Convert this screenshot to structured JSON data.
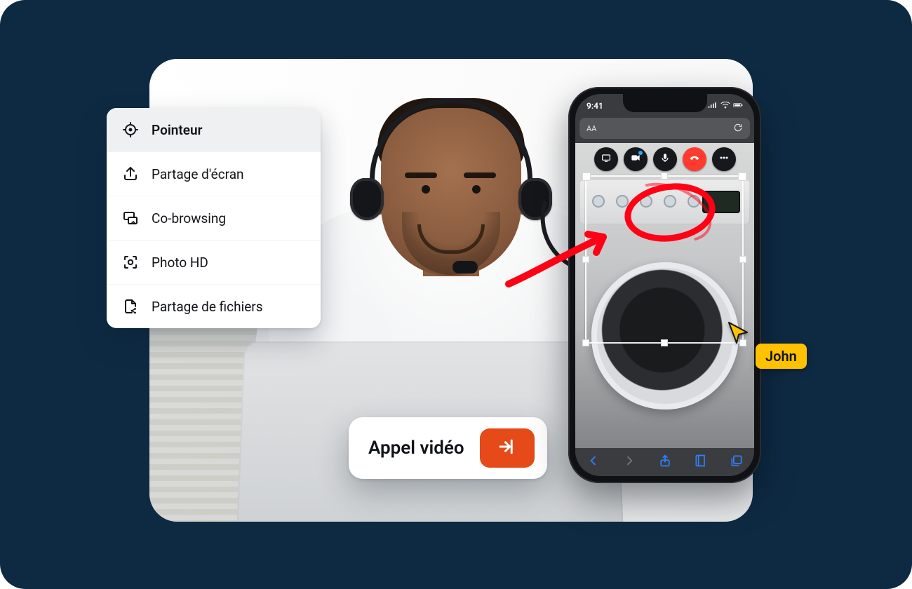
{
  "colors": {
    "background": "#0e2a43",
    "accent": "#e64a19",
    "cursor": "#ffc200",
    "annotation": "#ff0015",
    "safari_tint": "#2f80ff"
  },
  "tools_menu": {
    "items": [
      {
        "icon": "crosshair-icon",
        "label": "Pointeur",
        "selected": true
      },
      {
        "icon": "upload-icon",
        "label": "Partage d'écran",
        "selected": false
      },
      {
        "icon": "cobrowse-icon",
        "label": "Co-browsing",
        "selected": false
      },
      {
        "icon": "camera-focus-icon",
        "label": "Photo HD",
        "selected": false
      },
      {
        "icon": "file-share-icon",
        "label": "Partage de fichiers",
        "selected": false
      }
    ]
  },
  "cta": {
    "label": "Appel vidéo",
    "button_icon": "enter-arrow-icon"
  },
  "phone": {
    "status_time": "9:41",
    "address_bar_left": "AA",
    "address_bar_right_icon": "refresh-icon",
    "call_toolbar": [
      {
        "icon": "screen-icon",
        "style": "dark"
      },
      {
        "icon": "video-icon",
        "style": "dark",
        "indicator": true
      },
      {
        "icon": "microphone-icon",
        "style": "dark"
      },
      {
        "icon": "hangup-icon",
        "style": "red"
      },
      {
        "icon": "more-icon",
        "style": "dark"
      }
    ],
    "safari_bar_icons": [
      "back-icon",
      "forward-icon",
      "share-icon",
      "bookmarks-icon",
      "tabs-icon"
    ]
  },
  "remote_cursor": {
    "user_label": "John"
  }
}
